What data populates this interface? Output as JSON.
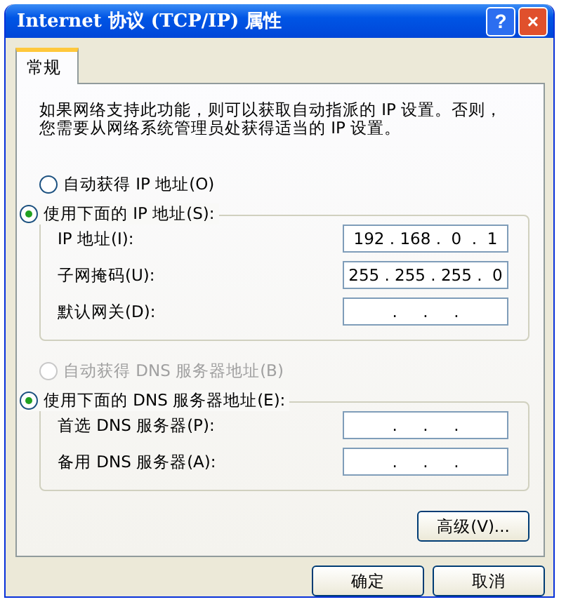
{
  "window": {
    "title": "Internet 协议 (TCP/IP) 属性",
    "buttons": [
      {
        "kind": "help",
        "label": "?"
      },
      {
        "kind": "close",
        "label": "×"
      }
    ]
  },
  "tabs": [
    {
      "label": "常规",
      "selected": true
    }
  ],
  "description": "如果网络支持此功能，则可以获取自动指派的 IP 设置。否则，您需要从网络系统管理员处获得适当的 IP 设置。",
  "ip_mode": {
    "options": [
      {
        "label": "自动获得 IP 地址(O)",
        "selected": false,
        "disabled": false
      },
      {
        "label": "使用下面的 IP 地址(S):",
        "selected": true,
        "disabled": false
      }
    ],
    "fields": [
      {
        "label": "IP 地址(I):",
        "value": "192 . 168 .  0  .  1"
      },
      {
        "label": "子网掩码(U):",
        "value": "255 . 255 . 255 .  0"
      },
      {
        "label": "默认网关(D):",
        "value": " .     .     . "
      }
    ]
  },
  "dns_mode": {
    "options": [
      {
        "label": "自动获得 DNS 服务器地址(B)",
        "selected": false,
        "disabled": true
      },
      {
        "label": "使用下面的 DNS 服务器地址(E):",
        "selected": true,
        "disabled": false
      }
    ],
    "fields": [
      {
        "label": "首选 DNS 服务器(P):",
        "value": " .     .     . "
      },
      {
        "label": "备用 DNS 服务器(A):",
        "value": " .     .     . "
      }
    ]
  },
  "advanced_button": "高级(V)...",
  "buttons": [
    "确定",
    "取消"
  ]
}
